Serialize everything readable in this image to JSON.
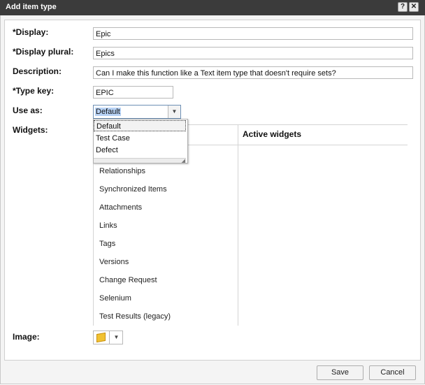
{
  "dialog": {
    "title": "Add item type",
    "help_label": "?",
    "close_label": "✕"
  },
  "form": {
    "display_label": "*Display:",
    "display_value": "Epic",
    "display_plural_label": "*Display plural:",
    "display_plural_value": "Epics",
    "description_label": "Description:",
    "description_value": "Can I make this function like a Text item type that doesn't require sets?",
    "type_key_label": "*Type key:",
    "type_key_value": "EPIC",
    "use_as_label": "Use as:",
    "use_as_value": "Default",
    "use_as_options": [
      "Default",
      "Test Case",
      "Defect"
    ],
    "widgets_label": "Widgets:",
    "image_label": "Image:"
  },
  "widgets": {
    "active_header": "Active widgets",
    "available": [
      "Relationships",
      "Synchronized Items",
      "Attachments",
      "Links",
      "Tags",
      "Versions",
      "Change Request",
      "Selenium",
      "Test Results (legacy)"
    ]
  },
  "buttons": {
    "save": "Save",
    "cancel": "Cancel"
  },
  "colors": {
    "titlebar": "#3b3b3b",
    "selection_highlight": "#b7d2f5"
  }
}
